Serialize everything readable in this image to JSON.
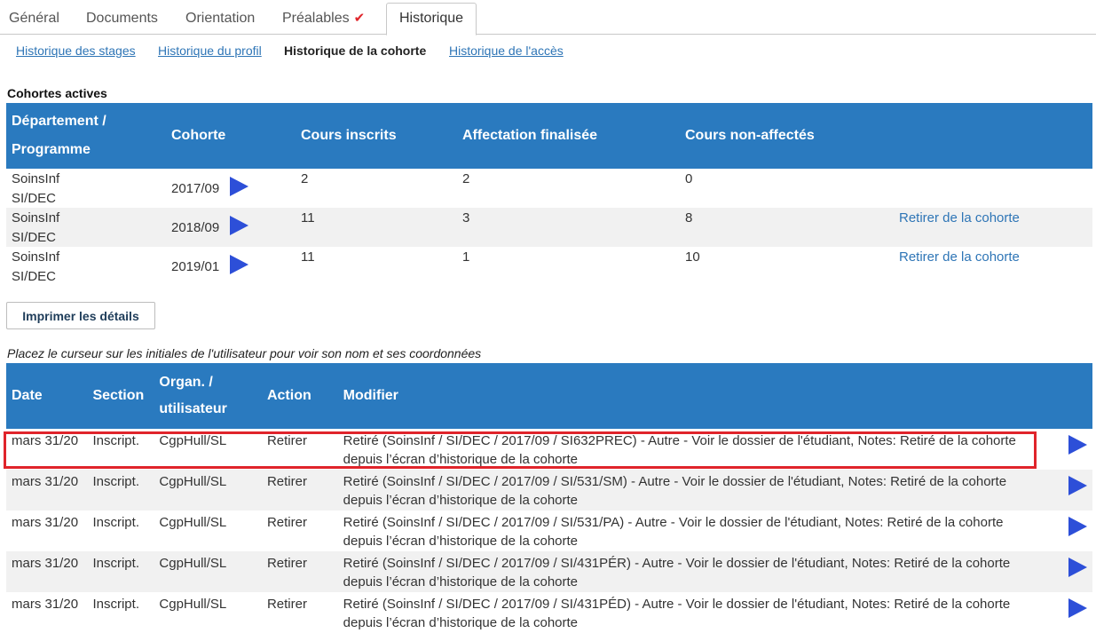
{
  "tabs": [
    {
      "label": "Général"
    },
    {
      "label": "Documents"
    },
    {
      "label": "Orientation"
    },
    {
      "label": "Préalables",
      "check": "✔"
    },
    {
      "label": "Historique"
    }
  ],
  "subnav": {
    "stages": "Historique des stages",
    "profil": "Historique du profil",
    "cohorte": "Historique de la cohorte",
    "acces": "Historique de l'accès"
  },
  "cohorts_title": "Cohortes actives",
  "cohorts_table": {
    "headers": {
      "dept_line1": "Département /",
      "dept_line2": "Programme",
      "cohorte": "Cohorte",
      "cours": "Cours inscrits",
      "affect": "Affectation finalisée",
      "nonaff": "Cours non-affectés"
    },
    "rows": [
      {
        "dept1": "SoinsInf",
        "dept2": "SI/DEC",
        "cohorte": "2017/09",
        "cours": "2",
        "affect": "2",
        "nonaff": "0",
        "action": ""
      },
      {
        "dept1": "SoinsInf",
        "dept2": "SI/DEC",
        "cohorte": "2018/09",
        "cours": "11",
        "affect": "3",
        "nonaff": "8",
        "action": "Retirer de la cohorte"
      },
      {
        "dept1": "SoinsInf",
        "dept2": "SI/DEC",
        "cohorte": "2019/01",
        "cours": "11",
        "affect": "1",
        "nonaff": "10",
        "action": "Retirer de la cohorte"
      }
    ]
  },
  "print_button": "Imprimer les détails",
  "hint": "Placez le curseur sur les initiales de l'utilisateur pour voir son nom et ses coordonnées",
  "history_table": {
    "headers": {
      "date": "Date",
      "section": "Section",
      "organ1": "Organ. /",
      "organ2": "utilisateur",
      "action": "Action",
      "modifier": "Modifier"
    },
    "rows": [
      {
        "date": "mars 31/20",
        "section": "Inscript.",
        "organ": "CgpHull/SL",
        "action": "Retirer",
        "modifier": "Retiré (SoinsInf / SI/DEC / 2017/09 / SI632PREC) - Autre - Voir le dossier de l'étudiant, Notes: Retiré de la cohorte depuis l’écran d’historique de la cohorte"
      },
      {
        "date": "mars 31/20",
        "section": "Inscript.",
        "organ": "CgpHull/SL",
        "action": "Retirer",
        "modifier": "Retiré (SoinsInf / SI/DEC / 2017/09 / SI/531/SM) - Autre - Voir le dossier de l'étudiant, Notes: Retiré de la cohorte depuis l’écran d’historique de la cohorte"
      },
      {
        "date": "mars 31/20",
        "section": "Inscript.",
        "organ": "CgpHull/SL",
        "action": "Retirer",
        "modifier": "Retiré (SoinsInf / SI/DEC / 2017/09 / SI/531/PA) - Autre - Voir le dossier de l'étudiant, Notes: Retiré de la cohorte depuis l’écran d’historique de la cohorte"
      },
      {
        "date": "mars 31/20",
        "section": "Inscript.",
        "organ": "CgpHull/SL",
        "action": "Retirer",
        "modifier": "Retiré (SoinsInf / SI/DEC / 2017/09 / SI/431PÉR) - Autre - Voir le dossier de l'étudiant, Notes: Retiré de la cohorte depuis l’écran d’historique de la cohorte"
      },
      {
        "date": "mars 31/20",
        "section": "Inscript.",
        "organ": "CgpHull/SL",
        "action": "Retirer",
        "modifier": "Retiré (SoinsInf / SI/DEC / 2017/09 / SI/431PÉD) - Autre - Voir le dossier de l'étudiant, Notes: Retiré de la cohorte depuis l’écran d’historique de la cohorte"
      }
    ]
  },
  "colors": {
    "header_bg": "#2a7abf",
    "play_icon": "#2d4fd8",
    "link": "#2e75b6",
    "highlight": "#e0242b"
  }
}
